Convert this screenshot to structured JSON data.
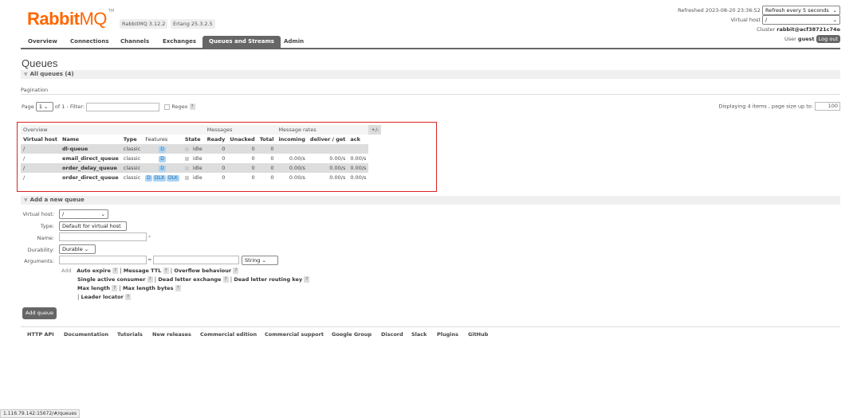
{
  "header": {
    "logo_bold": "Rabbit",
    "logo_light": "MQ",
    "logo_tm": "TM",
    "rabbitmq_version": "RabbitMQ 3.12.2",
    "erlang_version": "Erlang 25.3.2.5",
    "refreshed": "Refreshed 2023-08-20 23:36:52",
    "refresh_select": "Refresh every 5 seconds",
    "vhost_label": "Virtual host",
    "vhost_value": "/",
    "cluster_label": "Cluster",
    "cluster_value": "rabbit@acf38721c74e",
    "user_label": "User",
    "user_value": "guest",
    "logout": "Log out"
  },
  "nav": {
    "tabs": [
      "Overview",
      "Connections",
      "Channels",
      "Exchanges",
      "Queues and Streams",
      "Admin"
    ],
    "active": "Queues and Streams"
  },
  "page": {
    "title": "Queues",
    "all_queues": "All queues (4)",
    "pagination": "Pagination",
    "page_label": "Page",
    "page_value": "1",
    "of_label": "of 1",
    "filter_label": "- Filter:",
    "regex_label": "Regex",
    "help": "?",
    "displaying": "Displaying 4 items , page size up to:",
    "page_size": "100"
  },
  "table": {
    "groups": [
      "Overview",
      "Messages",
      "Message rates",
      "+/-"
    ],
    "headers": [
      "Virtual host",
      "Name",
      "Type",
      "Features",
      "State",
      "Ready",
      "Unacked",
      "Total",
      "incoming",
      "deliver / get",
      "ack"
    ],
    "rows": [
      {
        "vhost": "/",
        "name": "dl-queue",
        "type": "classic",
        "features": [
          "D"
        ],
        "state": "idle",
        "ready": "0",
        "unacked": "0",
        "total": "0",
        "incoming": "",
        "deliver": "",
        "ack": ""
      },
      {
        "vhost": "/",
        "name": "email_direct_queue",
        "type": "classic",
        "features": [
          "D"
        ],
        "state": "idle",
        "ready": "0",
        "unacked": "0",
        "total": "0",
        "incoming": "0.00/s",
        "deliver": "0.00/s",
        "ack": "0.00/s"
      },
      {
        "vhost": "/",
        "name": "order_delay_queue",
        "type": "classic",
        "features": [
          "D"
        ],
        "state": "idle",
        "ready": "0",
        "unacked": "0",
        "total": "0",
        "incoming": "0.00/s",
        "deliver": "0.00/s",
        "ack": "0.00/s"
      },
      {
        "vhost": "/",
        "name": "order_direct_queue",
        "type": "classic",
        "features": [
          "D",
          "DLX",
          "DLK"
        ],
        "state": "idle",
        "ready": "0",
        "unacked": "0",
        "total": "0",
        "incoming": "0.00/s",
        "deliver": "0.00/s",
        "ack": "0.00/s"
      }
    ]
  },
  "add_queue": {
    "section": "Add a new queue",
    "vhost_label": "Virtual host:",
    "vhost_value": "/",
    "type_label": "Type:",
    "type_value": "Default for virtual host",
    "name_label": "Name:",
    "required": "*",
    "durability_label": "Durability:",
    "durability_value": "Durable",
    "arguments_label": "Arguments:",
    "equals": "=",
    "arg_type": "String",
    "add_label": "Add",
    "args": {
      "auto_expire": "Auto expire",
      "message_ttl": "Message TTL",
      "overflow": "Overflow behaviour",
      "single_active": "Single active consumer",
      "dlx": "Dead letter exchange",
      "dlrk": "Dead letter routing key",
      "max_length": "Max length",
      "max_length_bytes": "Max length bytes",
      "leader_locator": "Leader locator"
    },
    "sep": "|",
    "button": "Add queue"
  },
  "footer": {
    "links": [
      "HTTP API",
      "Documentation",
      "Tutorials",
      "New releases",
      "Commercial edition",
      "Commercial support",
      "Google Group",
      "Discord",
      "Slack",
      "Plugins",
      "GitHub"
    ]
  },
  "status_url": "1.116.79.142:15672/#/queues"
}
